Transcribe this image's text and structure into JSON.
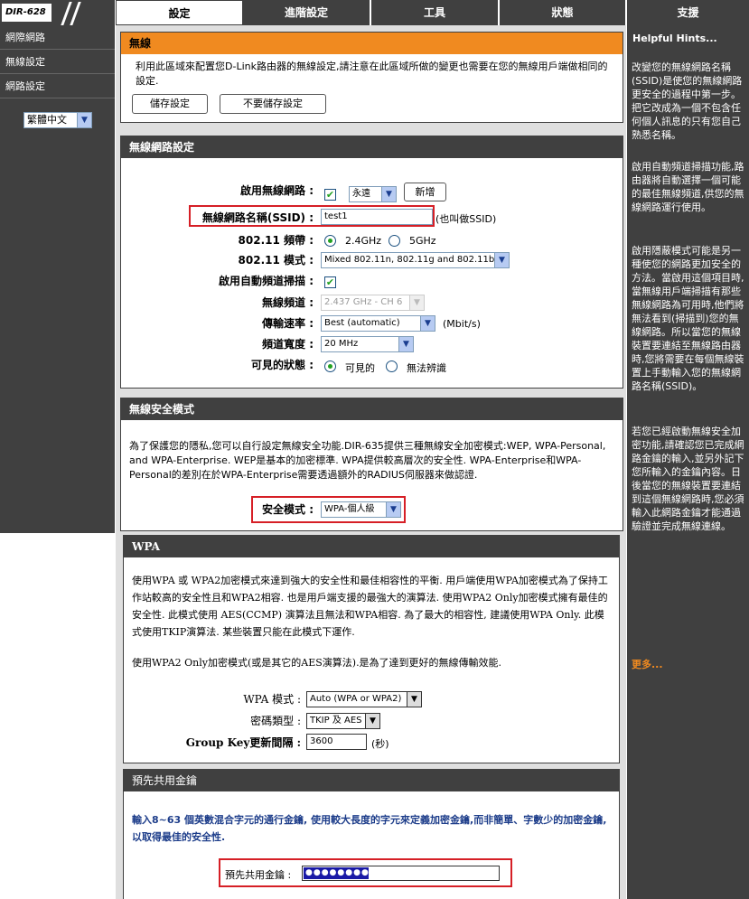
{
  "header": {
    "model": "DIR-628",
    "tabs": [
      "設定",
      "進階設定",
      "工具",
      "狀態",
      "支援"
    ]
  },
  "sidebar": {
    "items": [
      "網際網路",
      "無線設定",
      "網路設定"
    ],
    "language": "繁體中文"
  },
  "wireless": {
    "title": "無線",
    "description": "利用此區域來配置您D-Link路由器的無線設定,請注意在此區域所做的變更也需要在您的無線用戶端做相同的設定.",
    "save_label": "儲存設定",
    "dont_save_label": "不要儲存設定"
  },
  "network": {
    "title": "無線網路設定",
    "enable_label": "啟用無線網路 :",
    "enable_schedule": "永遠",
    "add_label": "新增",
    "ssid_label": "無線網路名稱(SSID) :",
    "ssid_value": "test1",
    "ssid_note": "(也叫做SSID)",
    "band_label": "802.11 頻帶 :",
    "band_options": [
      "2.4GHz",
      "5GHz"
    ],
    "mode_label": "802.11 模式 :",
    "mode_value": "Mixed 802.11n, 802.11g and 802.11b",
    "autochannel_label": "啟用自動頻道掃描 :",
    "channel_label": "無線頻道 :",
    "channel_value": "2.437 GHz - CH 6",
    "rate_label": "傳輸速率 :",
    "rate_value": "Best (automatic)",
    "rate_unit": "(Mbit/s)",
    "width_label": "頻道寬度 :",
    "width_value": "20 MHz",
    "visibility_label": "可見的狀態 :",
    "visibility_options": [
      "可見的",
      "無法辨識"
    ]
  },
  "security": {
    "title": "無線安全模式",
    "description": "為了保護您的隱私,您可以自行設定無線安全功能.DIR-635提供三種無線安全加密模式:WEP, WPA-Personal, and WPA-Enterprise. WEP是基本的加密標準. WPA提供較高層次的安全性. WPA-Enterprise和WPA-Personal的差別在於WPA-Enterprise需要透過額外的RADIUS伺服器來做認證.",
    "mode_label": "安全模式 :",
    "mode_value": "WPA-個人級"
  },
  "wpa": {
    "title": "WPA",
    "description": "使用WPA 或 WPA2加密模式來達到強大的安全性和最佳相容性的平衡. 用戶端使用WPA加密模式為了保持工作站較高的安全性且和WPA2相容. 也是用戶端支援的最強大的演算法. 使用WPA2 Only加密模式擁有最佳的安全性. 此模式使用 AES(CCMP) 演算法且無法和WPA相容. 為了最大的相容性, 建議使用WPA Only. 此模式使用TKIP演算法. 某些裝置只能在此模式下運作.",
    "note": "使用WPA2 Only加密模式(或是其它的AES演算法).是為了達到更好的無線傳輸效能.",
    "mode_label": "WPA 模式 :",
    "mode_value": "Auto (WPA or WPA2)",
    "cipher_label": "密碼類型 :",
    "cipher_value": "TKIP 及 AES",
    "rekey_label": "Group Key更新間隔 :",
    "rekey_value": "3600",
    "rekey_unit": "(秒)"
  },
  "psk": {
    "title": "預先共用金鑰",
    "description": "輸入8~63 個英數混合字元的通行金鑰, 使用較大長度的字元來定義加密金鑰,而非簡單、字數少的加密金鑰,以取得最佳的安全性.",
    "key_label": "預先共用金鑰 :",
    "key_value": "●●●●●●●●●●"
  },
  "hints": {
    "title": "Helpful Hints...",
    "items": [
      "改變您的無線網路名稱(SSID)是使您的無線網路更安全的過程中第一步。把它改成為一個不包含任何個人訊息的只有您自己熟悉名稱。",
      "啟用自動頻道掃描功能,路由器將自動選擇一個可能的最佳無線頻道,供您的無線網路運行使用。",
      "啟用隱蔽模式可能是另一種使您的網路更加安全的方法。當啟用這個項目時,當無線用戶端掃描有那些無線網路為可用時,他們將無法看到(掃描到)您的無線網路。所以當您的無線裝置要連結至無線路由器時,您將需要在每個無線裝置上手動輸入您的無線網路名稱(SSID)。",
      "若您已經啟動無線安全加密功能,請確認您已完成網路金鑰的輸入,並另外記下您所輸入的金鑰內容。日後當您的無線裝置要連結到這個無線網路時,您必須輸入此網路金鑰才能通過驗證並完成無線連線。"
    ],
    "more": "更多..."
  },
  "colors": {
    "dark": "#404040",
    "accent": "#f08a20",
    "highlight": "#d61f26",
    "check": "#21a121"
  }
}
